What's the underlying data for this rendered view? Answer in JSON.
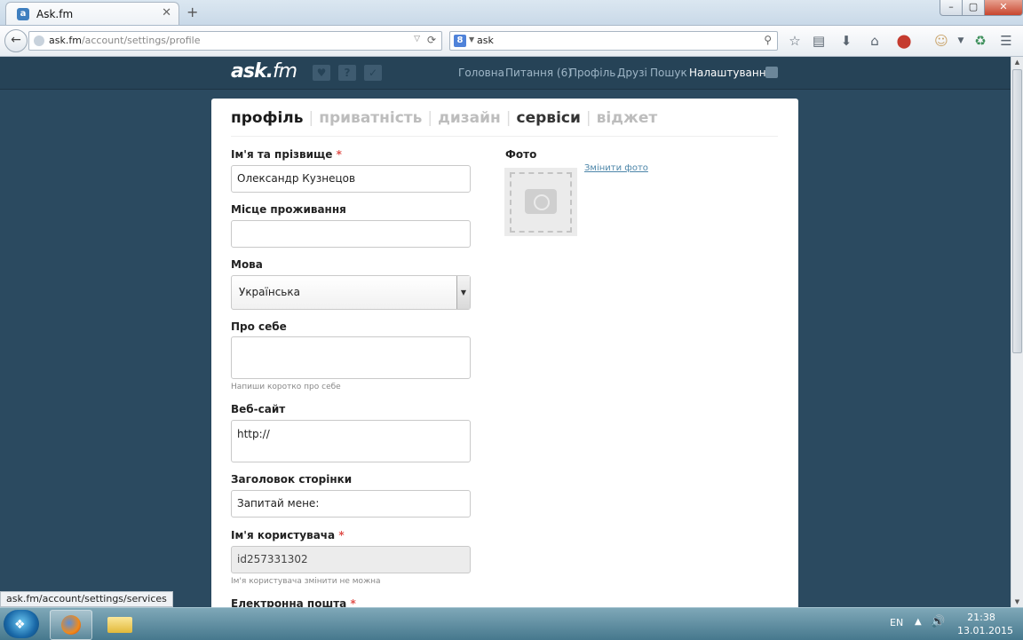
{
  "browser": {
    "tab_title": "Ask.fm",
    "tab_favicon": "a",
    "tab_close": "✕",
    "new_tab": "+",
    "url_host": "ask.fm",
    "url_path": "/account/settings/profile",
    "search_engine_icon": "8",
    "search_text": "ask",
    "win_min": "–",
    "win_max": "▢",
    "win_close": "✕",
    "icons": [
      "back-icon",
      "globe-icon",
      "reload-icon",
      "search-icon",
      "bookmark-star-icon",
      "reading-list-icon",
      "download-icon",
      "home-icon",
      "adblock-icon",
      "addon-icon",
      "sync-icon",
      "menu-icon"
    ]
  },
  "site": {
    "logo_main": "ask",
    "logo_dot": ".",
    "logo_tld": "fm",
    "nav": [
      "Головна",
      "Питання (6)",
      "Профіль",
      "Друзі",
      "Пошук",
      "Налаштування"
    ],
    "nav_active_index": 5
  },
  "settings": {
    "tabs": [
      "профіль",
      "приватність",
      "дизайн",
      "сервіси",
      "віджет"
    ],
    "active_tab": "профіль",
    "hover_tab": "сервіси",
    "fields": {
      "name_label": "Ім'я та прізвище",
      "name_value": "Олександр Кузнецов",
      "location_label": "Місце проживання",
      "location_value": "",
      "language_label": "Мова",
      "language_value": "Українська",
      "about_label": "Про себе",
      "about_value": "",
      "about_hint": "Напиши коротко про себе",
      "website_label": "Веб-сайт",
      "website_value": "http://",
      "page_title_label": "Заголовок сторінки",
      "page_title_value": "Запитай мене:",
      "username_label": "Ім'я користувача",
      "username_value": "id257331302",
      "username_hint": "Ім'я користувача змінити не можна",
      "email_label": "Електронна пошта"
    },
    "required_mark": "*",
    "photo_label": "Фото",
    "photo_link": "Змінити фото"
  },
  "status_link": "ask.fm/account/settings/services",
  "taskbar": {
    "lang": "EN",
    "time": "21:38",
    "date": "13.01.2015"
  }
}
